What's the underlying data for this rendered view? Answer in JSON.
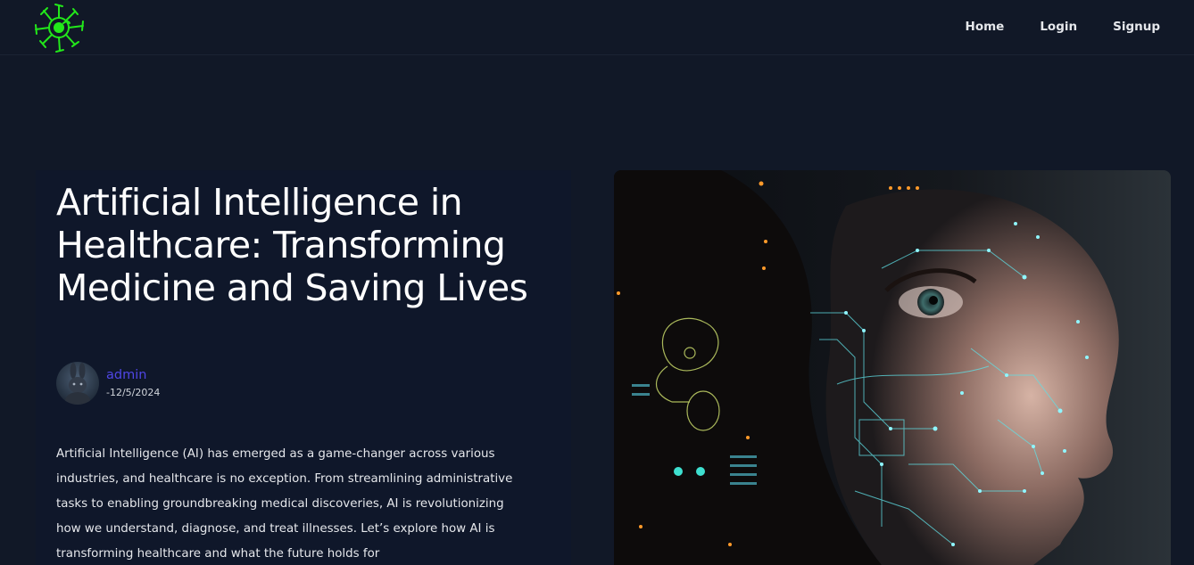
{
  "nav": {
    "links": [
      "Home",
      "Login",
      "Signup"
    ]
  },
  "article": {
    "title": "Artificial Intelligence in Healthcare: Transforming Medicine and Saving Lives",
    "author": "admin",
    "date": "-12/5/2024",
    "intro": "Artificial Intelligence (AI) has emerged as a game-changer across various industries, and healthcare is no exception. From streamlining administrative tasks to enabling groundbreaking medical discoveries, AI is revolutionizing how we understand, diagnose, and treat illnesses. Let’s explore how AI is transforming healthcare and what the future holds for"
  },
  "colors": {
    "background": "#111827",
    "accent": "#4f46e5",
    "logo": "#22e81a"
  },
  "icons": {
    "logo": "virus-logo-icon",
    "avatar": "bunny-avatar",
    "hero": "ai-face-image"
  }
}
